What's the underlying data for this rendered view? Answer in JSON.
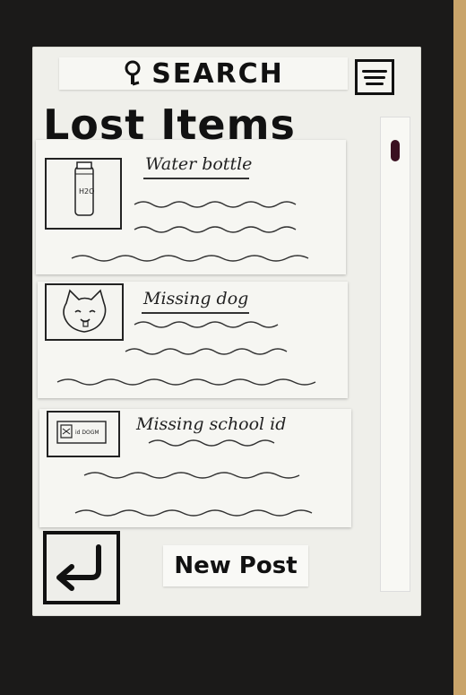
{
  "header": {
    "search_label": "SEARCH",
    "title": "Lost Items"
  },
  "items": [
    {
      "title": "Water bottle",
      "icon": "water-bottle-icon",
      "thumb_text": "H2O"
    },
    {
      "title": "Missing dog",
      "icon": "dog-icon"
    },
    {
      "title": "Missing school id",
      "icon": "id-card-icon",
      "thumb_text": "id DOGM"
    }
  ],
  "footer": {
    "new_post_label": "New Post"
  },
  "colors": {
    "background": "#1b1a19",
    "paper": "#efefea",
    "ink": "#111111",
    "scroll_thumb": "#3a1020"
  }
}
